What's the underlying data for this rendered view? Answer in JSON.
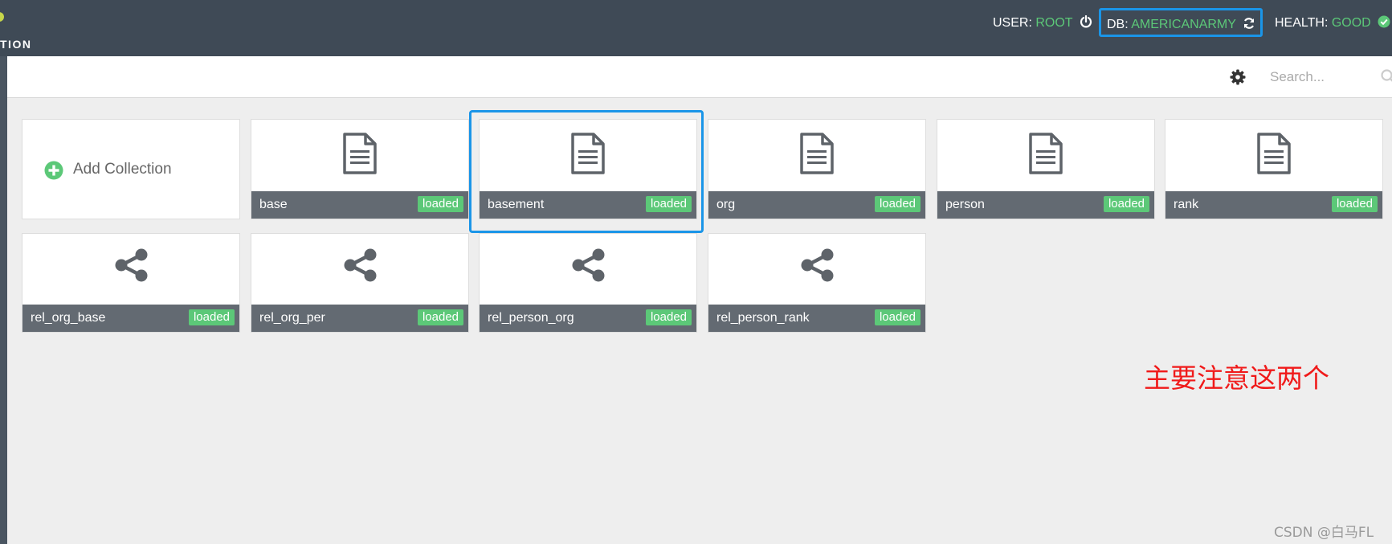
{
  "header": {
    "brand_partial": "TION",
    "user": {
      "label": "USER:",
      "value": "ROOT"
    },
    "db": {
      "label": "DB:",
      "value": "AMERICANARMY"
    },
    "health": {
      "label": "HEALTH:",
      "value": "GOOD"
    }
  },
  "toolbar": {
    "search_placeholder": "Search..."
  },
  "add_collection_label": "Add Collection",
  "collections": [
    {
      "name": "base",
      "status": "loaded",
      "type": "document"
    },
    {
      "name": "basement",
      "status": "loaded",
      "type": "document"
    },
    {
      "name": "org",
      "status": "loaded",
      "type": "document"
    },
    {
      "name": "person",
      "status": "loaded",
      "type": "document"
    },
    {
      "name": "rank",
      "status": "loaded",
      "type": "document"
    },
    {
      "name": "rel_org_base",
      "status": "loaded",
      "type": "edge"
    },
    {
      "name": "rel_org_per",
      "status": "loaded",
      "type": "edge"
    },
    {
      "name": "rel_person_org",
      "status": "loaded",
      "type": "edge"
    },
    {
      "name": "rel_person_rank",
      "status": "loaded",
      "type": "edge"
    }
  ],
  "annotation_text": "主要注意这两个",
  "watermark": "CSDN @白马FL",
  "colors": {
    "topbar": "#3f4a56",
    "accent_green": "#5cc878",
    "highlight_blue": "#1a95e8",
    "annotation_red": "#f01a1a"
  }
}
